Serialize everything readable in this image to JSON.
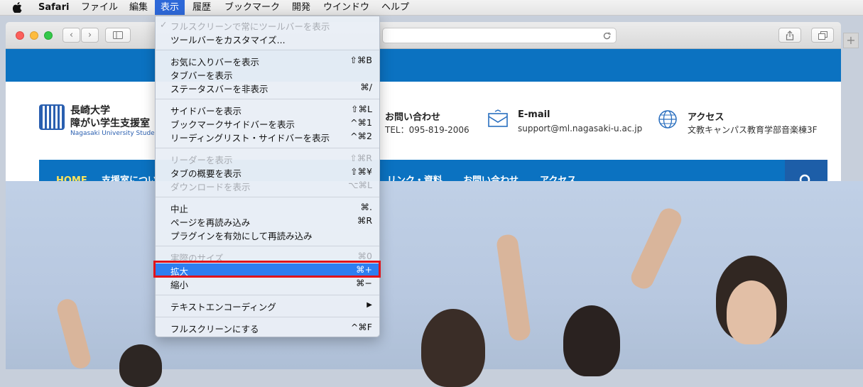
{
  "menubar": {
    "app": "Safari",
    "items": [
      "ファイル",
      "編集",
      "表示",
      "履歴",
      "ブックマーク",
      "開発",
      "ウインドウ",
      "ヘルプ"
    ],
    "active_index": 2
  },
  "site": {
    "logo": {
      "line1": "長崎大学",
      "line2": "障がい学生支援室",
      "line3": "Nagasaki University Studer"
    },
    "contact": {
      "title": "お問い合わせ",
      "value": "TEL：095-819-2006"
    },
    "email": {
      "title": "E-mail",
      "value": "support@ml.nagasaki-u.ac.jp"
    },
    "access": {
      "title": "アクセス",
      "value": "文教キャンパス教育学部音楽棟3F"
    },
    "nav": [
      "HOME",
      "支援室につい",
      "リンク・資料",
      "お問い合わせ",
      "アクセス"
    ]
  },
  "view_menu": {
    "items": [
      {
        "label": "フルスクリーンで常にツールバーを表示",
        "shortcut": "",
        "disabled": true,
        "checked": true
      },
      {
        "label": "ツールバーをカスタマイズ...",
        "shortcut": ""
      },
      {
        "label": "お気に入りバーを表示",
        "shortcut": "⇧⌘B"
      },
      {
        "label": "タブバーを表示",
        "shortcut": ""
      },
      {
        "label": "ステータスバーを非表示",
        "shortcut": "⌘/"
      },
      {
        "label": "サイドバーを表示",
        "shortcut": "⇧⌘L"
      },
      {
        "label": "ブックマークサイドバーを表示",
        "shortcut": "^⌘1"
      },
      {
        "label": "リーディングリスト・サイドバーを表示",
        "shortcut": "^⌘2"
      },
      {
        "label": "リーダーを表示",
        "shortcut": "⇧⌘R",
        "disabled": true
      },
      {
        "label": "タブの概要を表示",
        "shortcut": "⇧⌘¥"
      },
      {
        "label": "ダウンロードを表示",
        "shortcut": "⌥⌘L",
        "disabled": true
      },
      {
        "label": "中止",
        "shortcut": "⌘."
      },
      {
        "label": "ページを再読み込み",
        "shortcut": "⌘R"
      },
      {
        "label": "プラグインを有効にして再読み込み",
        "shortcut": ""
      },
      {
        "label": "実際のサイズ",
        "shortcut": "⌘0",
        "disabled": true
      },
      {
        "label": "拡大",
        "shortcut": "⌘+",
        "highlighted": true
      },
      {
        "label": "縮小",
        "shortcut": "⌘−"
      },
      {
        "label": "テキストエンコーディング",
        "shortcut": "▶"
      },
      {
        "label": "フルスクリーンにする",
        "shortcut": "^⌘F"
      }
    ]
  },
  "colors": {
    "site_blue": "#0b72c1",
    "nav_home": "#ffe45c",
    "menu_highlight": "#2e7ef0",
    "annotation_red": "#e0141b"
  }
}
